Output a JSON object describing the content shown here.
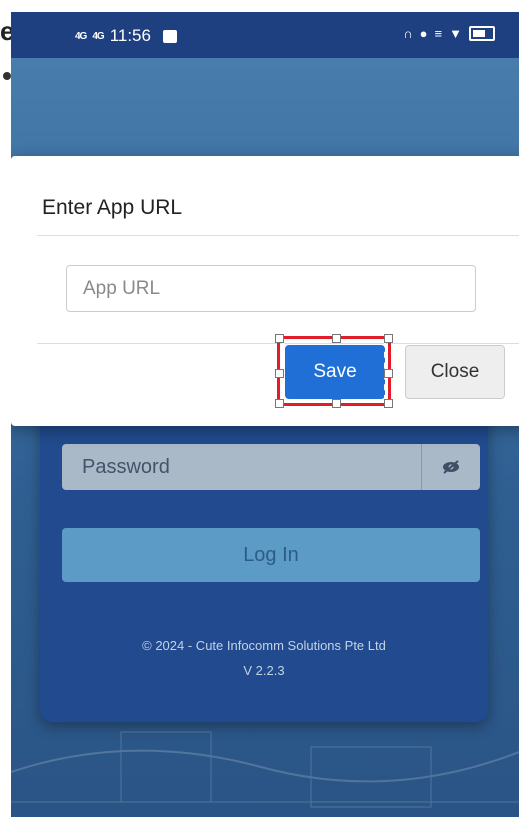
{
  "status_bar": {
    "signal_1": "4G",
    "signal_2": "4G",
    "time": "11:56",
    "icons": [
      "image-icon",
      "headset-icon",
      "alarm-icon",
      "vibrate-icon",
      "wifi-icon",
      "battery-icon"
    ]
  },
  "stray_glyph": "e",
  "dialog": {
    "title": "Enter App URL",
    "input": {
      "placeholder": "App URL",
      "value": ""
    },
    "save_label": "Save",
    "close_label": "Close"
  },
  "login": {
    "password_placeholder": "Password",
    "eye_icon": "eye-slash-icon",
    "login_label": "Log In",
    "copyright": "© 2024 - Cute Infocomm Solutions Pte Ltd",
    "version": "V 2.2.3"
  },
  "colors": {
    "status_bar": "#1e3f80",
    "card": "#214b8e",
    "primary_button": "#1f6fd6",
    "selection_outline": "#e11d2a"
  }
}
